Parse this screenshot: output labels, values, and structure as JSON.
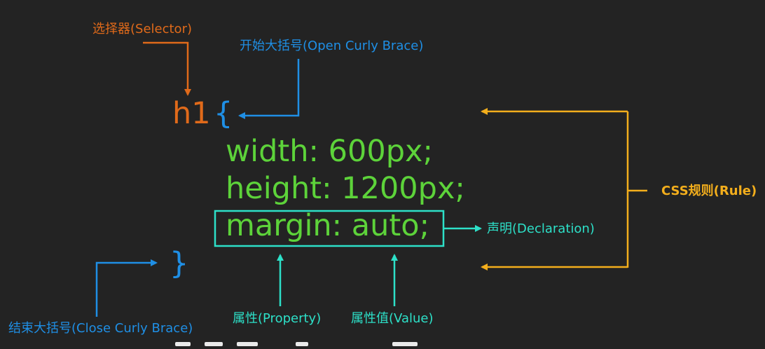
{
  "colors": {
    "background": "#232323",
    "selector": "#e06a1a",
    "brace": "#1f8fe5",
    "code": "#5dd33a",
    "declaration": "#2de0c8",
    "rule": "#f3ae1c"
  },
  "labels": {
    "selector": "选择器(Selector)",
    "open_brace": "开始大括号(Open Curly Brace)",
    "close_brace": "结束大括号(Close Curly Brace)",
    "rule": "CSS规则(Rule)",
    "declaration": "声明(Declaration)",
    "property": "属性(Property)",
    "value": "属性值(Value)"
  },
  "code": {
    "selector": "h1",
    "open_brace": "{",
    "close_brace": "}",
    "lines": [
      "width: 600px;",
      "height: 1200px;",
      "margin: auto;"
    ]
  }
}
